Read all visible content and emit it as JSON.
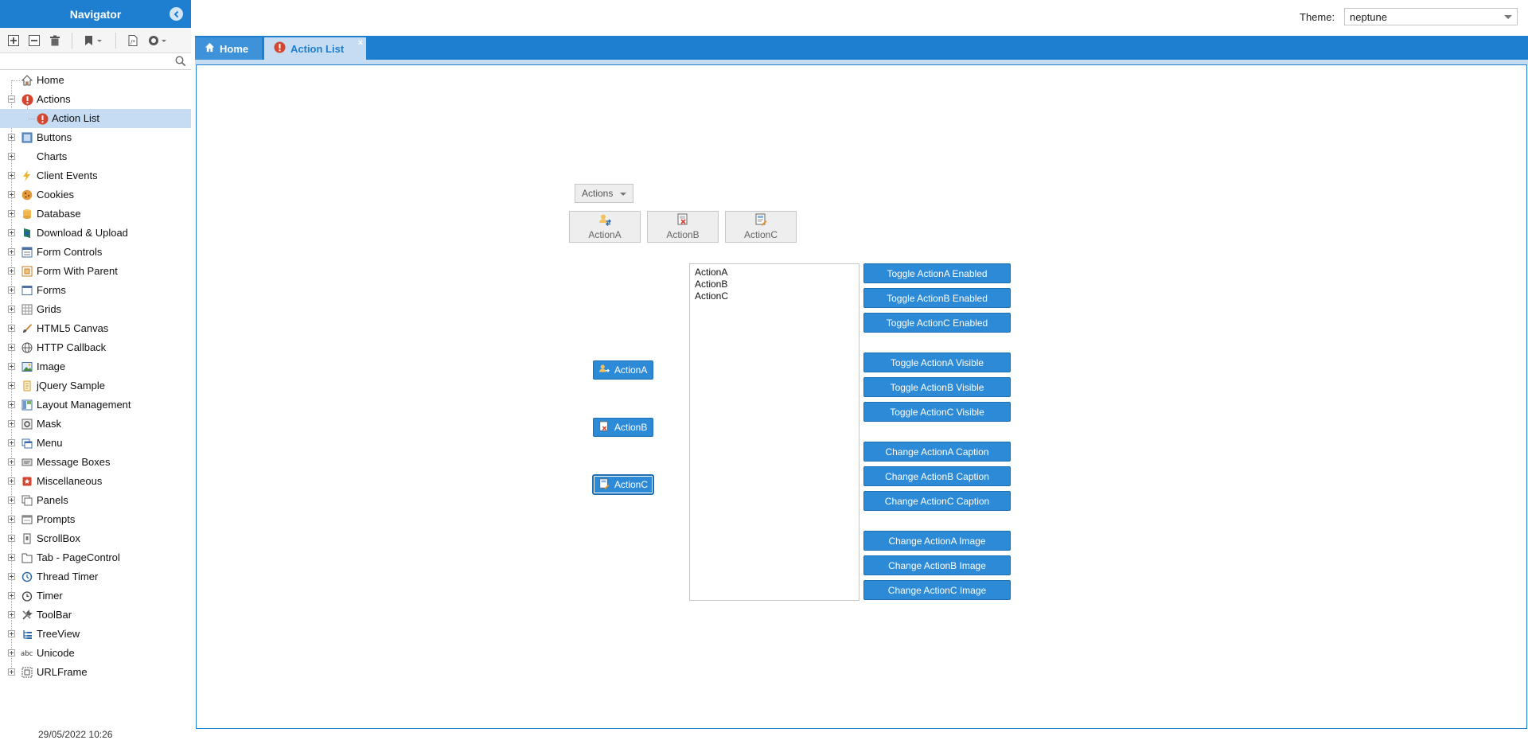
{
  "navigator": {
    "title": "Navigator",
    "search_placeholder": "",
    "items": [
      {
        "label": "Home",
        "icon": "home-icon"
      },
      {
        "label": "Actions",
        "icon": "alert-icon"
      },
      {
        "label": "Action List",
        "icon": "alert-icon"
      },
      {
        "label": "Buttons",
        "icon": "button-icon"
      },
      {
        "label": "Charts",
        "icon": "chart-icon"
      },
      {
        "label": "Client Events",
        "icon": "lightning-icon"
      },
      {
        "label": "Cookies",
        "icon": "cookie-icon"
      },
      {
        "label": "Database",
        "icon": "database-icon"
      },
      {
        "label": "Download & Upload",
        "icon": "download-icon"
      },
      {
        "label": "Form Controls",
        "icon": "form-controls-icon"
      },
      {
        "label": "Form With Parent",
        "icon": "form-parent-icon"
      },
      {
        "label": "Forms",
        "icon": "window-icon"
      },
      {
        "label": "Grids",
        "icon": "grid-icon"
      },
      {
        "label": "HTML5 Canvas",
        "icon": "brush-icon"
      },
      {
        "label": "HTTP Callback",
        "icon": "globe-icon"
      },
      {
        "label": "Image",
        "icon": "image-icon"
      },
      {
        "label": "jQuery Sample",
        "icon": "script-icon"
      },
      {
        "label": "Layout Management",
        "icon": "layout-icon"
      },
      {
        "label": "Mask",
        "icon": "mask-icon"
      },
      {
        "label": "Menu",
        "icon": "menu-icon"
      },
      {
        "label": "Message Boxes",
        "icon": "message-box-icon"
      },
      {
        "label": "Miscellaneous",
        "icon": "misc-icon"
      },
      {
        "label": "Panels",
        "icon": "panels-icon"
      },
      {
        "label": "Prompts",
        "icon": "prompt-icon"
      },
      {
        "label": "ScrollBox",
        "icon": "scrollbox-icon"
      },
      {
        "label": "Tab - PageControl",
        "icon": "tab-icon"
      },
      {
        "label": "Thread Timer",
        "icon": "thread-timer-icon"
      },
      {
        "label": "Timer",
        "icon": "timer-icon"
      },
      {
        "label": "ToolBar",
        "icon": "toolbar-icon"
      },
      {
        "label": "TreeView",
        "icon": "treeview-icon"
      },
      {
        "label": "Unicode",
        "icon": "abc-icon"
      },
      {
        "label": "URLFrame",
        "icon": "urlframe-icon"
      }
    ],
    "footer_datetime": "29/05/2022 10:26"
  },
  "theme": {
    "label": "Theme:",
    "value": "neptune"
  },
  "tabs": [
    {
      "label": "Home",
      "icon": "home-icon"
    },
    {
      "label": "Action List",
      "icon": "alert-icon",
      "close": "×"
    }
  ],
  "content": {
    "actions_menu_label": "Actions",
    "toolbar_buttons": [
      "ActionA",
      "ActionB",
      "ActionC"
    ],
    "action_buttons": [
      "ActionA",
      "ActionB",
      "ActionC"
    ],
    "listbox_items": [
      "ActionA",
      "ActionB",
      "ActionC"
    ],
    "command_buttons": [
      "Toggle ActionA Enabled",
      "Toggle ActionB Enabled",
      "Toggle ActionC Enabled",
      "Toggle ActionA Visible",
      "Toggle ActionB Visible",
      "Toggle ActionC Visible",
      "Change ActionA Caption",
      "Change ActionB Caption",
      "Change ActionC Caption",
      "Change ActionA Image",
      "Change ActionB Image",
      "Change ActionC Image"
    ]
  },
  "colors": {
    "accent": "#1e7fd0",
    "button_blue": "#2d8ad6",
    "selected_row": "#c5dcf2"
  }
}
